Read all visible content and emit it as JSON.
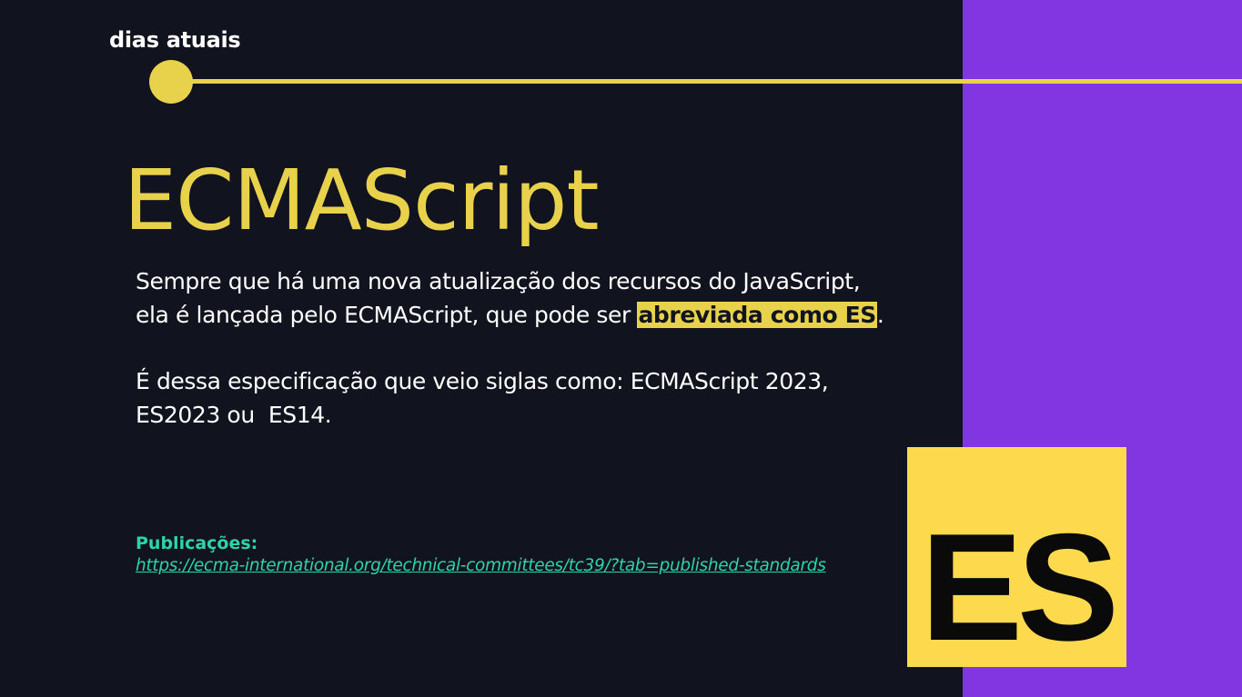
{
  "slide": {
    "section_label": "dias atuais",
    "title": "ECMAScript",
    "paragraph1": {
      "line1": "Sempre que há uma nova atualização dos recursos do JavaScript,",
      "line2_before": "ela é lançada pelo ECMAScript, que pode ser ",
      "line2_highlight": "abreviada como ES",
      "line2_after": "."
    },
    "paragraph2": {
      "line1": "É dessa especificação que veio siglas como: ECMAScript 2023,",
      "line2": "ES2023 ou  ES14."
    },
    "publications": {
      "label": "Publicações:",
      "link": "https://ecma-international.org/technical-committees/tc39/?tab=published-standards"
    },
    "logo": {
      "text": "ES"
    }
  },
  "colors": {
    "background": "#11131f",
    "accent_yellow": "#e9d24b",
    "panel_purple": "#8236e2",
    "link_green": "#2ed3a8",
    "logo_yellow": "#fcd94d"
  }
}
